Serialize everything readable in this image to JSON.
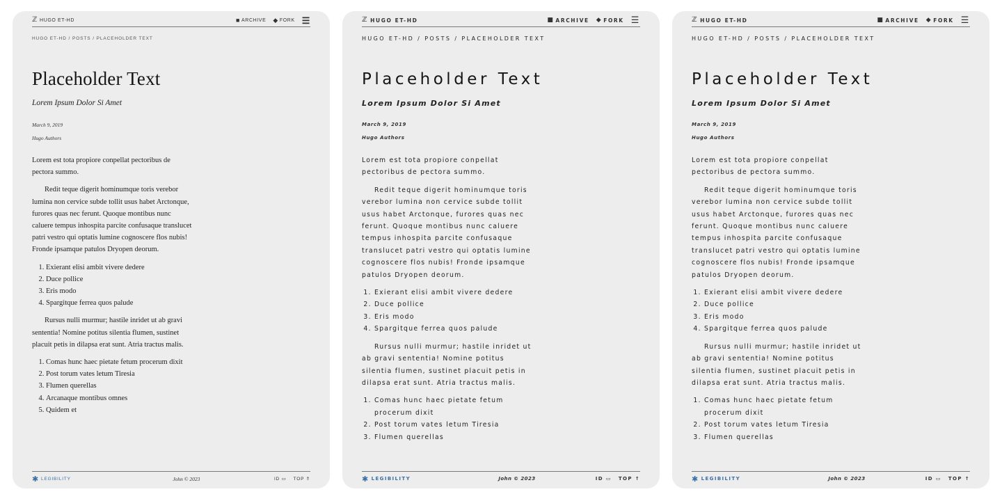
{
  "nav": {
    "brand": "HUGO ET-HD",
    "archive": "ARCHIVE",
    "fork": "FORK"
  },
  "breadcrumb": {
    "home": "HUGO ET-HD",
    "section": "POSTS",
    "current": "PLACEHOLDER TEXT",
    "sep": "/"
  },
  "post": {
    "title": "Placeholder Text",
    "subtitle": "Lorem Ipsum Dolor Si Amet",
    "date": "March 9, 2019",
    "author": "Hugo Authors",
    "p1": "Lorem est tota propiore conpellat pectoribus de pectora summo.",
    "p2": "Redit teque digerit hominumque toris verebor lumina non cervice subde tollit usus habet Arctonque, furores quas nec ferunt. Quoque montibus nunc caluere tempus inhospita parcite confusaque translucet patri vestro qui optatis lumine cognoscere flos nubis! Fronde ipsamque patulos Dryopen deorum.",
    "list1": [
      "Exierant elisi ambit vivere dedere",
      "Duce pollice",
      "Eris modo",
      "Spargitque ferrea quos palude"
    ],
    "p3": "Rursus nulli murmur; hastile inridet ut ab gravi sententia! Nomine potitus silentia flumen, sustinet placuit petis in dilapsa erat sunt. Atria tractus malis.",
    "list2": [
      "Comas hunc haec pietate fetum procerum dixit",
      "Post torum vates letum Tiresia",
      "Flumen querellas",
      "Arcanaque montibus omnes",
      "Quidem et"
    ]
  },
  "footer": {
    "legibility": "LEGIBILITY",
    "copyright": "John © 2023",
    "id": "ID",
    "top": "TOP"
  }
}
